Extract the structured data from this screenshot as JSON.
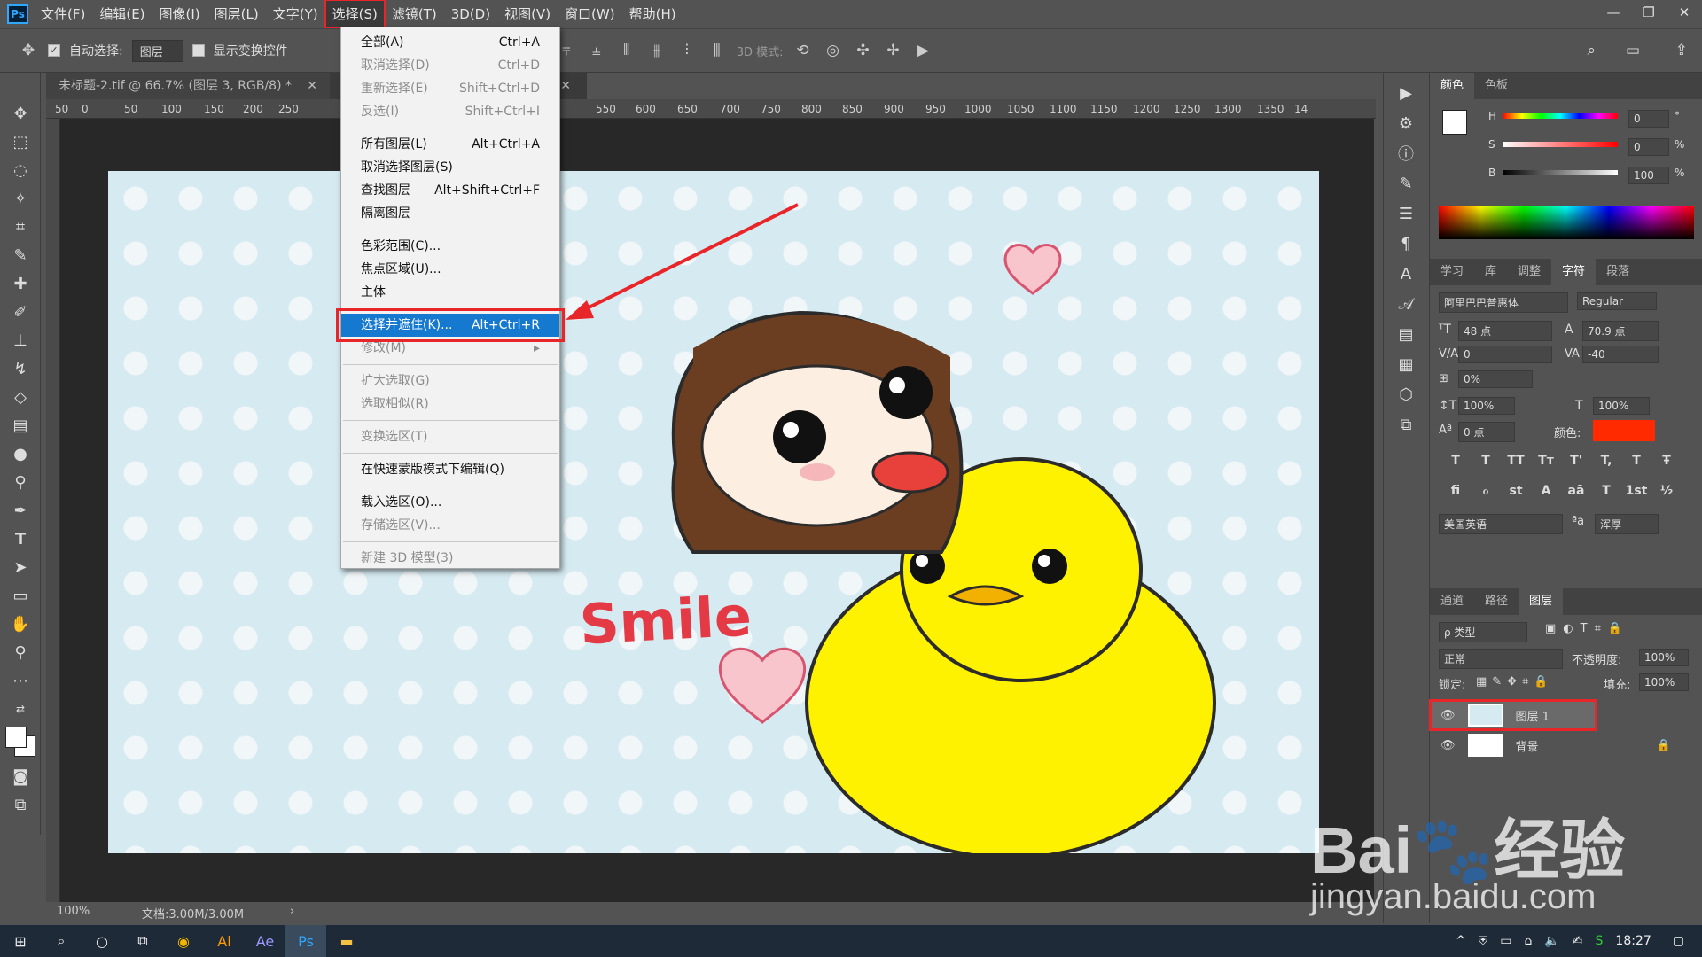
{
  "app": {
    "logo": "Ps"
  },
  "menubar": {
    "items": [
      "文件(F)",
      "编辑(E)",
      "图像(I)",
      "图层(L)",
      "文字(Y)",
      "选择(S)",
      "滤镜(T)",
      "3D(D)",
      "视图(V)",
      "窗口(W)",
      "帮助(H)"
    ],
    "active_index": 5
  },
  "window_controls": [
    "—",
    "❐",
    "✕"
  ],
  "optbar": {
    "auto_select_label": "自动选择:",
    "auto_select_value": "图层",
    "show_transform_label": "显示变换控件",
    "mode_3d_label": "3D 模式:"
  },
  "document": {
    "tab_title": "未标题-2.tif @ 66.7% (图层 3, RGB/8) *",
    "second_tab_close": "✕",
    "zoom": "100%",
    "doc_size": "文档:3.00M/3.00M"
  },
  "ruler": {
    "ticks": [
      "50",
      "0",
      "50",
      "100",
      "150",
      "200",
      "250",
      "550",
      "600",
      "650",
      "700",
      "750",
      "800",
      "850",
      "900",
      "950",
      "1000",
      "1050",
      "1100",
      "1150",
      "1200",
      "1250",
      "1300",
      "1350",
      "14"
    ]
  },
  "select_menu": {
    "items": [
      {
        "label": "全部(A)",
        "shortcut": "Ctrl+A",
        "enabled": true
      },
      {
        "label": "取消选择(D)",
        "shortcut": "Ctrl+D",
        "enabled": false
      },
      {
        "label": "重新选择(E)",
        "shortcut": "Shift+Ctrl+D",
        "enabled": false
      },
      {
        "label": "反选(I)",
        "shortcut": "Shift+Ctrl+I",
        "enabled": false
      },
      {
        "sep": true
      },
      {
        "label": "所有图层(L)",
        "shortcut": "Alt+Ctrl+A",
        "enabled": true
      },
      {
        "label": "取消选择图层(S)",
        "shortcut": "",
        "enabled": true
      },
      {
        "label": "查找图层",
        "shortcut": "Alt+Shift+Ctrl+F",
        "enabled": true
      },
      {
        "label": "隔离图层",
        "shortcut": "",
        "enabled": true
      },
      {
        "sep": true
      },
      {
        "label": "色彩范围(C)...",
        "shortcut": "",
        "enabled": true
      },
      {
        "label": "焦点区域(U)...",
        "shortcut": "",
        "enabled": true
      },
      {
        "label": "主体",
        "shortcut": "",
        "enabled": true
      },
      {
        "sep": true
      },
      {
        "label": "选择并遮住(K)...",
        "shortcut": "Alt+Ctrl+R",
        "enabled": true,
        "highlight": true
      },
      {
        "label": "修改(M)",
        "shortcut": "▸",
        "enabled": false
      },
      {
        "sep": true
      },
      {
        "label": "扩大选取(G)",
        "shortcut": "",
        "enabled": false
      },
      {
        "label": "选取相似(R)",
        "shortcut": "",
        "enabled": false
      },
      {
        "sep": true
      },
      {
        "label": "变换选区(T)",
        "shortcut": "",
        "enabled": false
      },
      {
        "sep": true
      },
      {
        "label": "在快速蒙版模式下编辑(Q)",
        "shortcut": "",
        "enabled": true
      },
      {
        "sep": true
      },
      {
        "label": "载入选区(O)...",
        "shortcut": "",
        "enabled": true
      },
      {
        "label": "存储选区(V)...",
        "shortcut": "",
        "enabled": false
      },
      {
        "sep": true
      },
      {
        "label": "新建 3D 模型(3)",
        "shortcut": "",
        "enabled": false
      }
    ]
  },
  "color_panel": {
    "tabs": [
      "颜色",
      "色板"
    ],
    "h_label": "H",
    "h_value": "0",
    "h_unit": "°",
    "s_label": "S",
    "s_value": "0",
    "s_unit": "%",
    "b_label": "B",
    "b_value": "100",
    "b_unit": "%"
  },
  "char_panel": {
    "tabs": [
      "学习",
      "库",
      "调整",
      "字符",
      "段落"
    ],
    "font": "阿里巴巴普惠体",
    "style": "Regular",
    "size": "48 点",
    "leading": "70.9 点",
    "kerning": "0",
    "tracking": "-40",
    "scale_pct": "0%",
    "vscale": "100%",
    "hscale": "100%",
    "baseline": "0 点",
    "color_label": "颜色:",
    "text_color": "#ff2a00",
    "language": "美国英语",
    "aa_label": "ªa",
    "antialias": "浑厚",
    "style_buttons": [
      "T",
      "T",
      "TT",
      "Tт",
      "T'",
      "T,",
      "T",
      "Ŧ"
    ],
    "ot_buttons": [
      "fi",
      "ℴ",
      "st",
      "A",
      "aā",
      "T",
      "1st",
      "½"
    ]
  },
  "layers_panel": {
    "tabs": [
      "通道",
      "路径",
      "图层"
    ],
    "filter": "ρ 类型",
    "blend": "正常",
    "opacity_label": "不透明度:",
    "opacity": "100%",
    "lock_label": "锁定:",
    "fill_label": "填充:",
    "fill": "100%",
    "layers": [
      {
        "name": "图层 1",
        "selected": true
      },
      {
        "name": "背景",
        "locked": true
      }
    ]
  },
  "artwork": {
    "text": "Smile"
  },
  "watermark": {
    "brand": "Bai",
    "brand2": "经验",
    "url": "jingyan.baidu.com"
  },
  "taskbar": {
    "time": "18:27"
  }
}
